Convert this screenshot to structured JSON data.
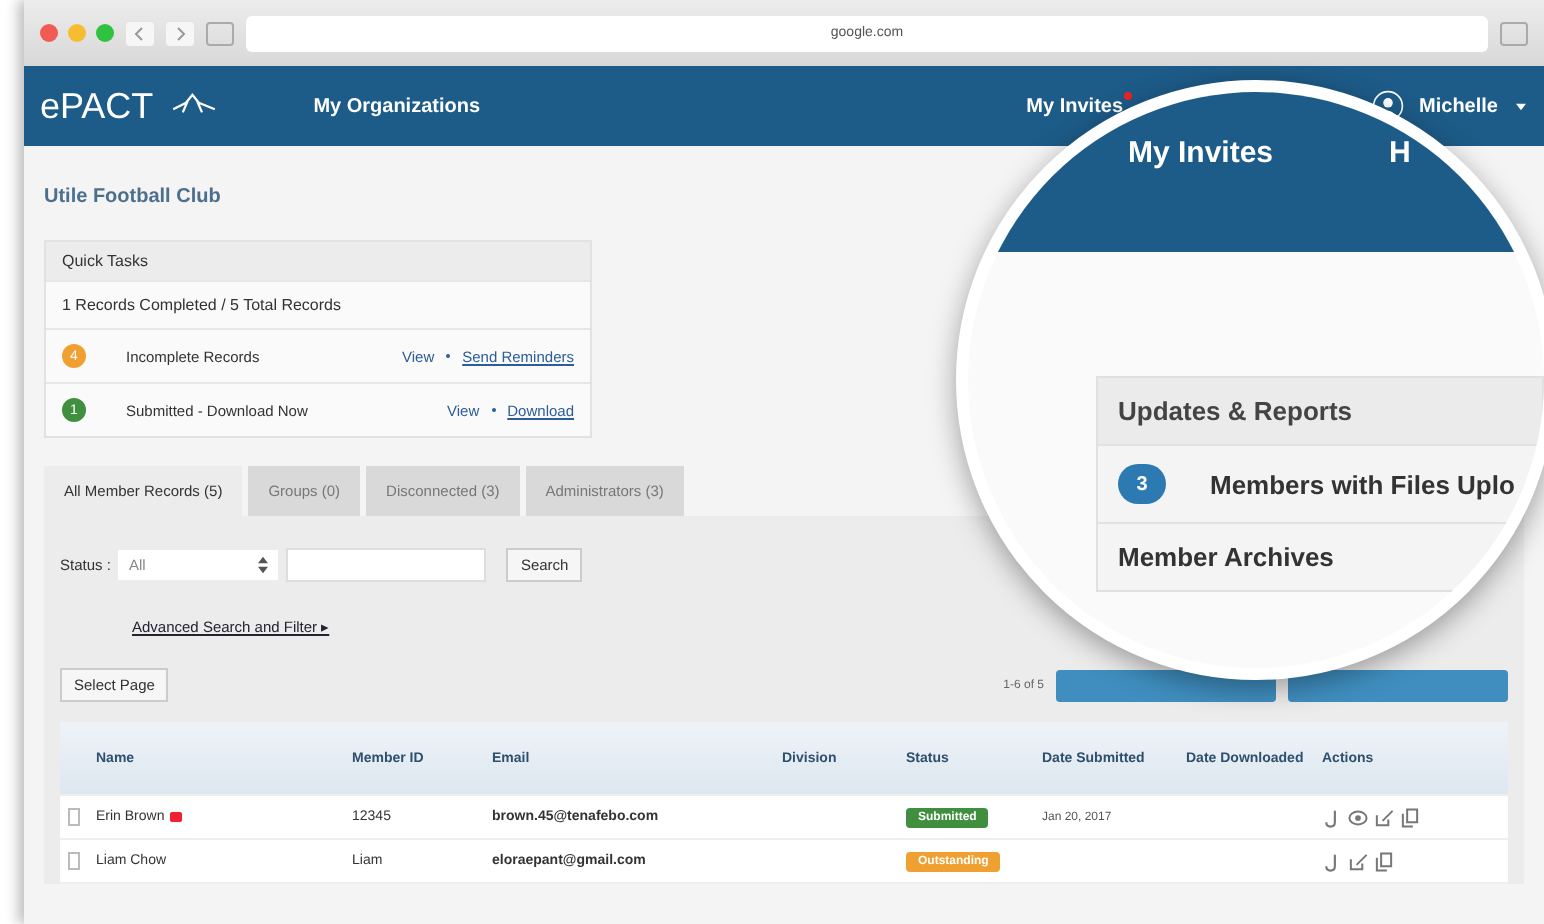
{
  "browser": {
    "url": "google.com"
  },
  "nav": {
    "logo": "ePACT",
    "links": [
      "My Organizations"
    ],
    "invites": {
      "label": "My Invites",
      "notification": true
    },
    "user": "Michelle"
  },
  "org_title": "Utile Football Club",
  "quick_tasks": {
    "title": "Quick Tasks",
    "summary": "1 Records Completed / 5 Total Records",
    "items": [
      {
        "count": "4",
        "color": "#f0a030",
        "label": "Incomplete Records",
        "view": "View",
        "action": "Send Reminders"
      },
      {
        "count": "1",
        "color": "#3f8f3f",
        "label": "Submitted - Download Now",
        "view": "View",
        "action": "Download"
      }
    ]
  },
  "tabs": [
    {
      "label": "All Member Records (5)",
      "selected": true
    },
    {
      "label": "Groups (0)",
      "selected": false
    },
    {
      "label": "Disconnected (3)",
      "selected": false
    },
    {
      "label": "Administrators (3)",
      "selected": false
    }
  ],
  "filter": {
    "label": "Status :",
    "status_value": "All",
    "search_button": "Search",
    "advanced_link": "Advanced Search and Filter ▸"
  },
  "select_page": "Select Page",
  "pager": "1-6 of 5",
  "table": {
    "columns": [
      "Name",
      "Member ID",
      "Email",
      "Division",
      "Status",
      "Date Submitted",
      "Date Downloaded",
      "Actions"
    ],
    "rows": [
      {
        "name": "Erin Brown",
        "flag": true,
        "member_id": "12345",
        "email": "brown.45@tenafebo.com",
        "status": {
          "kind": "submitted",
          "label": "Submitted"
        },
        "date_submitted": "Jan 20, 2017",
        "checked": false,
        "viewable": true
      },
      {
        "name": "Liam Chow",
        "flag": false,
        "member_id": "Liam",
        "email": "eloraepant@gmail.com",
        "status": {
          "kind": "outstanding",
          "label": "Outstanding"
        },
        "checked": false,
        "viewable": false
      }
    ]
  },
  "magnifier": {
    "nav_links": [
      "My Invites",
      "H"
    ],
    "panel_title": "Updates & Reports",
    "items": [
      {
        "kind": "count",
        "count": "3",
        "label": "Members with Files Uplo"
      },
      {
        "kind": "plain",
        "label": "Member Archives"
      }
    ]
  }
}
